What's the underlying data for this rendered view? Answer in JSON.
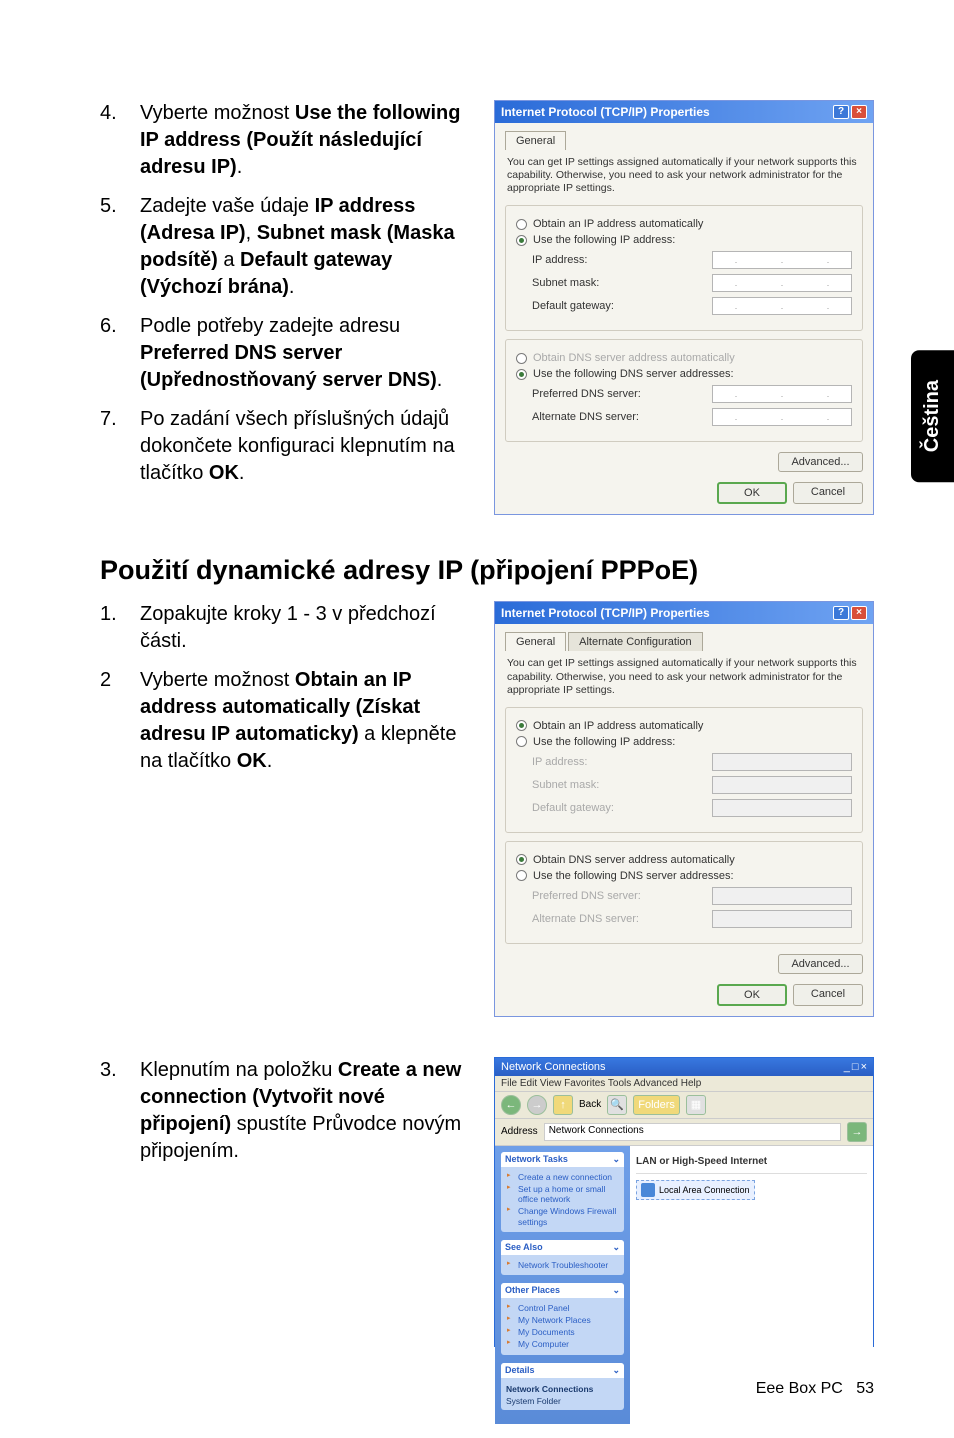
{
  "side_tab": "Čeština",
  "section1": {
    "items": [
      {
        "n": "4.",
        "html": "Vyberte možnost <b>Use the following IP address (Použít následující adresu IP)</b>."
      },
      {
        "n": "5.",
        "html": "Zadejte vaše údaje <b>IP address (Adresa IP)</b>, <b>Subnet mask (Maska podsítě)</b> a <b>Default gateway (Výchozí brána)</b>."
      },
      {
        "n": "6.",
        "html": "Podle potřeby zadejte adresu <b>Preferred DNS server (Upřednostňovaný server DNS)</b>."
      },
      {
        "n": "7.",
        "html": "Po zadání všech příslušných údajů dokončete konfiguraci klepnutím na tlačítko <b>OK</b>."
      }
    ]
  },
  "heading2": "Použití dynamické adresy IP (připojení PPPoE)",
  "section2": {
    "items": [
      {
        "n": "1.",
        "html": "Zopakujte kroky 1 - 3 v předchozí části."
      },
      {
        "n": "2",
        "html": "Vyberte možnost <b>Obtain an IP address automatically (Získat adresu IP automaticky)</b> a klepněte na tlačítko <b>OK</b>."
      }
    ]
  },
  "section3": {
    "items": [
      {
        "n": "3.",
        "html": "Klepnutím na položku <b>Create a new connection (Vytvořit nové připojení)</b> spustíte Průvodce novým připojením."
      }
    ]
  },
  "dialog": {
    "title": "Internet Protocol (TCP/IP) Properties",
    "tab_general": "General",
    "tab_alt": "Alternate Configuration",
    "desc": "You can get IP settings assigned automatically if your network supports this capability. Otherwise, you need to ask your network administrator for the appropriate IP settings.",
    "r_obtain_ip": "Obtain an IP address automatically",
    "r_use_ip": "Use the following IP address:",
    "f_ip": "IP address:",
    "f_subnet": "Subnet mask:",
    "f_gateway": "Default gateway:",
    "r_obtain_dns": "Obtain DNS server address automatically",
    "r_use_dns": "Use the following DNS server addresses:",
    "f_pref_dns": "Preferred DNS server:",
    "f_alt_dns": "Alternate DNS server:",
    "btn_advanced": "Advanced...",
    "btn_ok": "OK",
    "btn_cancel": "Cancel"
  },
  "nc": {
    "title": "Network Connections",
    "menubar": "File  Edit  View  Favorites  Tools  Advanced  Help",
    "tool_back": "Back",
    "tool_folders": "Folders",
    "addr": "Address",
    "cat1": "LAN or High-Speed Internet",
    "conn1": "Local Area Connection",
    "panel_tasks": "Network Tasks",
    "task_create": "Create a new connection",
    "task_home": "Set up a home or small office network",
    "task_fw": "Change Windows Firewall settings",
    "panel_see": "See Also",
    "see_trouble": "Network Troubleshooter",
    "panel_other": "Other Places",
    "other_cp": "Control Panel",
    "other_net": "My Network Places",
    "other_docs": "My Documents",
    "other_comp": "My Computer",
    "panel_details": "Details",
    "details_nc": "Network Connections",
    "details_sf": "System Folder"
  },
  "footer": {
    "product": "Eee Box PC",
    "page": "53"
  }
}
